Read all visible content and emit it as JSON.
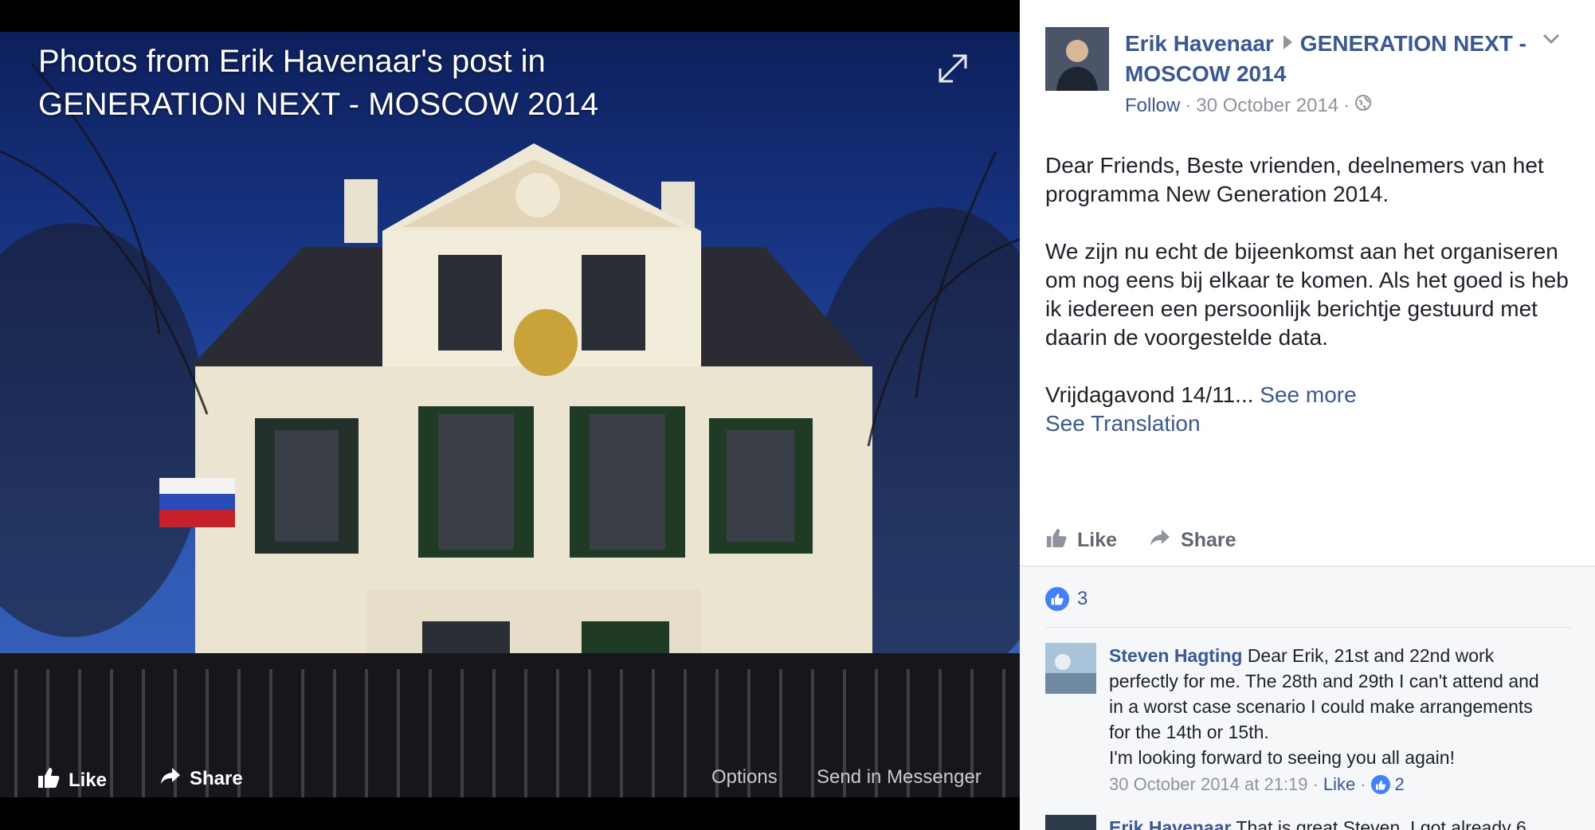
{
  "viewer": {
    "title": "Photos from Erik Havenaar's post in GENERATION NEXT - MOSCOW 2014",
    "like_label": "Like",
    "share_label": "Share",
    "options_label": "Options",
    "messenger_label": "Send in Messenger"
  },
  "post": {
    "author": "Erik Havenaar",
    "group": "GENERATION NEXT - MOSCOW 2014",
    "follow": "Follow",
    "date": "30 October 2014",
    "para1": "Dear Friends, Beste vrienden, deelnemers van het programma New Generation 2014.",
    "para2": "We zijn nu echt de bijeenkomst aan het organiseren om nog eens bij elkaar te komen. Als het goed is heb ik iedereen een persoonlijk berichtje gestuurd met daarin de voorgestelde data.",
    "para3": "Vrijdagavond 14/11...",
    "see_more": "See more",
    "see_translation": "See Translation",
    "like_label": "Like",
    "share_label": "Share",
    "like_count": "3"
  },
  "comments": [
    {
      "name": "Steven Hagting",
      "text": "Dear Erik, 21st and 22nd work perfectly for me. The 28th and 29th I can't attend and in a worst case scenario I could make arrangements for the 14th or 15th.",
      "text2": "I'm looking forward to seeing you all again!",
      "time": "30 October 2014 at 21:19",
      "like": "Like",
      "likes": "2"
    },
    {
      "name": "Erik Havenaar",
      "text": "That is great Steven. I got already 6"
    }
  ],
  "colors": {
    "link": "#385898",
    "meta": "#90949c",
    "like_blue": "#4080ff"
  },
  "icons": [
    "expand-icon",
    "thumbs-up-icon",
    "share-arrow-icon",
    "globe-icon",
    "chevron-down-icon"
  ]
}
